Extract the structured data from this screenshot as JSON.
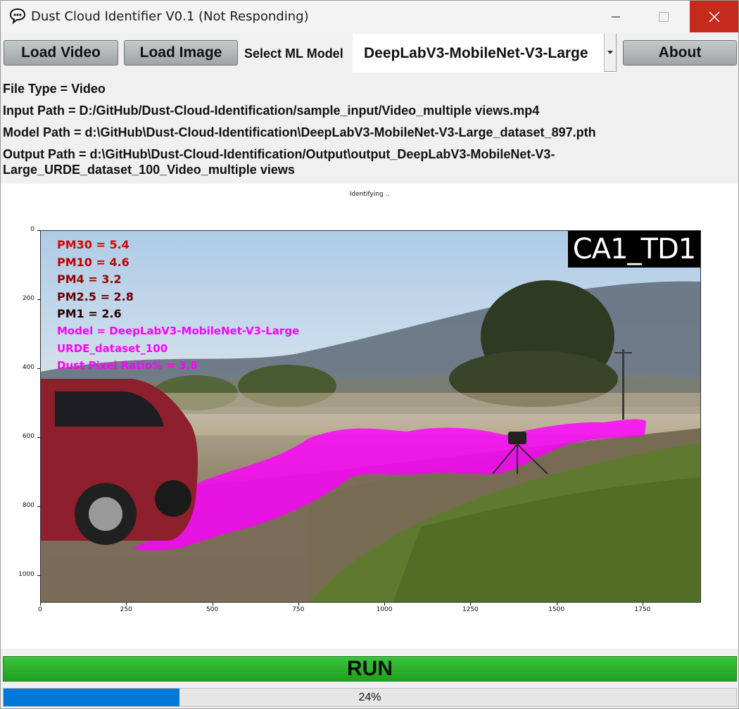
{
  "window": {
    "title": "Dust Cloud Identifier V0.1 (Not Responding)"
  },
  "toolbar": {
    "load_video_label": "Load Video",
    "load_image_label": "Load Image",
    "select_model_label": "Select ML Model",
    "model_selected": "DeepLabV3-MobileNet-V3-Large",
    "about_label": "About"
  },
  "info": {
    "file_type": "File Type = Video",
    "input_path": "Input Path = D:/GitHub/Dust-Cloud-Identification/sample_input/Video_multiple views.mp4",
    "model_path": "Model Path = d:\\GitHub\\Dust-Cloud-Identification\\DeepLabV3-MobileNet-V3-Large_dataset_897.pth",
    "output_path_line1": "Output Path = d:\\GitHub\\Dust-Cloud-Identification/Output\\output_DeepLabV3-MobileNet-V3-",
    "output_path_line2": "Large_URDE_dataset_100_Video_multiple views"
  },
  "plot": {
    "status": "Identifying ..",
    "y_ticks": [
      "0",
      "200",
      "400",
      "600",
      "800",
      "1000"
    ],
    "x_ticks": [
      "0",
      "250",
      "500",
      "750",
      "1000",
      "1250",
      "1500",
      "1750"
    ],
    "x_range": [
      0,
      1920
    ],
    "y_range": [
      0,
      1080
    ],
    "overlay": {
      "pm30": "PM30 = 5.4",
      "pm10": "PM10 = 4.6",
      "pm4": "PM4 = 3.2",
      "pm25": "PM2.5 = 2.8",
      "pm1": "PM1 = 2.6",
      "model": "Model = DeepLabV3-MobileNet-V3-Large",
      "dataset": "URDE_dataset_100",
      "ratio": "Dust Pixel Ratio% = 3.8"
    },
    "camera_label": "CA1_TD1",
    "mask_color": "#ff00ff"
  },
  "run": {
    "label": "RUN",
    "color": "#2aad2a"
  },
  "progress": {
    "value": 0.24,
    "text": "24%",
    "color": "#0078d7"
  },
  "icons": {
    "app": "speech-bubble-icon",
    "minimize": "minimize-icon",
    "maximize": "maximize-icon",
    "close": "close-icon",
    "dropdown": "chevron-down-icon"
  }
}
